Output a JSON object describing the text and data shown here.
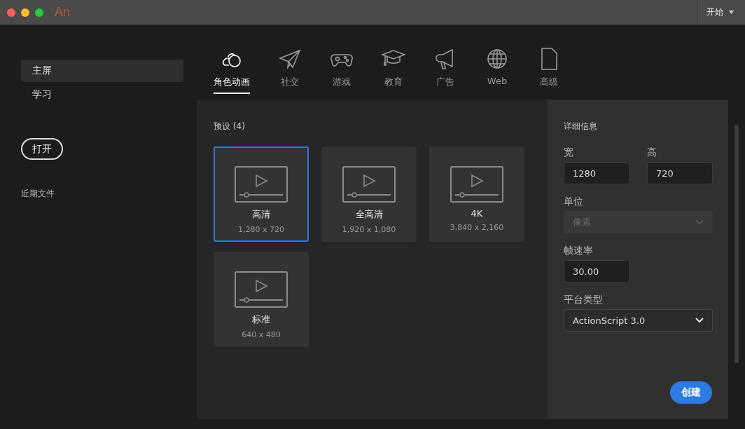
{
  "title_bar": {
    "logo": "An",
    "workspace": "开始"
  },
  "sidebar": {
    "items": [
      {
        "label": "主屏",
        "selected": true
      },
      {
        "label": "学习",
        "selected": false
      }
    ],
    "open_button": "打开",
    "recent_heading": "近期文件"
  },
  "tabs": [
    {
      "label": "角色动画",
      "selected": true
    },
    {
      "label": "社交",
      "selected": false
    },
    {
      "label": "游戏",
      "selected": false
    },
    {
      "label": "教育",
      "selected": false
    },
    {
      "label": "广告",
      "selected": false
    },
    {
      "label": "Web",
      "selected": false
    },
    {
      "label": "高级",
      "selected": false
    }
  ],
  "presets": {
    "heading": "预设 (4)",
    "items": [
      {
        "name": "高清",
        "size": "1,280 x 720",
        "selected": true
      },
      {
        "name": "全高清",
        "size": "1,920 x 1,080",
        "selected": false
      },
      {
        "name": "4K",
        "size": "3,840 x 2,160",
        "selected": false
      },
      {
        "name": "标准",
        "size": "640 x 480",
        "selected": false
      }
    ]
  },
  "details": {
    "heading": "详细信息",
    "width": {
      "label": "宽",
      "value": "1280"
    },
    "height": {
      "label": "高",
      "value": "720"
    },
    "unit": {
      "label": "单位",
      "value": "像素",
      "disabled": true
    },
    "frame_rate": {
      "label": "帧速率",
      "value": "30.00"
    },
    "platform": {
      "label": "平台类型",
      "value": "ActionScript 3.0",
      "disabled": false
    },
    "create_button": "创建"
  }
}
